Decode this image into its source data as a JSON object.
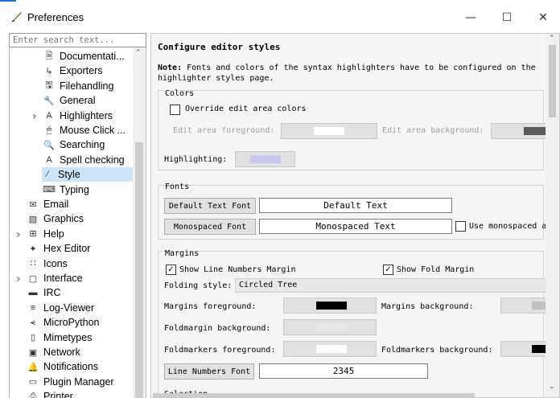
{
  "window": {
    "title": "Preferences",
    "minimize": "—",
    "maximize": "☐",
    "close": "✕"
  },
  "search": {
    "placeholder": "Enter search text..."
  },
  "tree": {
    "items": [
      {
        "label": "Documentati...",
        "icon": "document-icon"
      },
      {
        "label": "Exporters",
        "icon": "export-icon"
      },
      {
        "label": "Filehandling",
        "icon": "save-icon"
      },
      {
        "label": "General",
        "icon": "wrench-icon"
      },
      {
        "label": "Highlighters",
        "icon": "highlighter-icon"
      },
      {
        "label": "Mouse Click ...",
        "icon": "mouse-icon"
      },
      {
        "label": "Searching",
        "icon": "search-icon"
      },
      {
        "label": "Spell checking",
        "icon": "spell-icon"
      },
      {
        "label": "Style",
        "icon": "style-icon"
      },
      {
        "label": "Typing",
        "icon": "keyboard-icon"
      },
      {
        "label": "Email",
        "icon": "email-icon"
      },
      {
        "label": "Graphics",
        "icon": "graphics-icon"
      },
      {
        "label": "Help",
        "icon": "help-icon"
      },
      {
        "label": "Hex Editor",
        "icon": "hex-editor-icon"
      },
      {
        "label": "Icons",
        "icon": "icons-icon"
      },
      {
        "label": "Interface",
        "icon": "interface-icon"
      },
      {
        "label": "IRC",
        "icon": "irc-icon"
      },
      {
        "label": "Log-Viewer",
        "icon": "log-viewer-icon"
      },
      {
        "label": "MicroPython",
        "icon": "micropython-icon"
      },
      {
        "label": "Mimetypes",
        "icon": "mimetypes-icon"
      },
      {
        "label": "Network",
        "icon": "network-icon"
      },
      {
        "label": "Notifications",
        "icon": "bell-icon"
      },
      {
        "label": "Plugin Manager",
        "icon": "plugin-icon"
      },
      {
        "label": "Printer",
        "icon": "printer-icon"
      }
    ]
  },
  "page": {
    "heading": "Configure editor styles",
    "note_bold": "Note:",
    "note_text": " Fonts and colors of the syntax highlighters have to be configured on the",
    "note_text2": "highlighter styles page.",
    "colors": {
      "title": "Colors",
      "override_label": "Override edit area colors",
      "fg_label": "Edit area foreground:",
      "bg_label": "Edit area background:",
      "highlighting_label": "Highlighting:",
      "fg_color": "#ffffff",
      "bg_color": "#5a5a5a",
      "highlight_color": "#c8c8ef"
    },
    "fonts": {
      "title": "Fonts",
      "default_btn": "Default Text Font",
      "default_sample": "Default Text",
      "mono_btn": "Monospaced Font",
      "mono_sample": "Monospaced Text",
      "use_mono_label": "Use monospaced a"
    },
    "margins": {
      "title": "Margins",
      "show_line_numbers": "Show Line Numbers Margin",
      "show_fold": "Show Fold Margin",
      "folding_style_label": "Folding style:",
      "folding_style_value": "Circled Tree",
      "margins_fg_label": "Margins foreground:",
      "margins_bg_label": "Margins background:",
      "foldmargin_bg_label": "Foldmargin background:",
      "foldmarkers_fg_label": "Foldmarkers foreground:",
      "foldmarkers_bg_label": "Foldmarkers background:",
      "line_numbers_font_btn": "Line Numbers Font",
      "line_numbers_sample": "2345",
      "margins_fg_color": "#000000",
      "margins_bg_color": "#c0c0c0",
      "foldmargin_bg_color": "#e6e6e6",
      "foldmarkers_fg_color": "#ffffff",
      "foldmarkers_bg_color": "#000000"
    },
    "next_group_title": "Selection"
  }
}
